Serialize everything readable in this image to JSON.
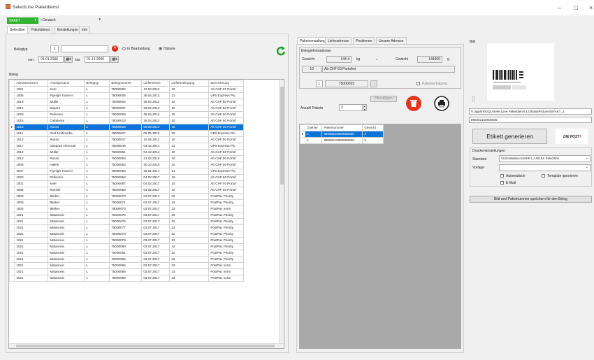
{
  "window": {
    "title": "SelectLine Paketdienst"
  },
  "top": {
    "mandant": "SFAKT",
    "language": "Deutsch"
  },
  "menu_tabs": [
    "Selectline",
    "Paketdienst",
    "Einstellungen",
    "Info"
  ],
  "filter": {
    "belegtyp_label": "Belegtyp",
    "belegtyp_value": "L",
    "von_label": "von",
    "von_value": "01.01.2000",
    "bis_label": "bis",
    "bis_value": "01.12.2050",
    "radio1": "In Bearbeitung",
    "radio2": "Historie"
  },
  "beleg_label": "Beleg",
  "table": {
    "columns": [
      "Adressnummer",
      "Anzeigename",
      "Belegtyp",
      "Belegnummer",
      "Liefertermin",
      "Lieferbedingung",
      "Bezeichnung"
    ],
    "rows": [
      [
        "1001",
        "Keel",
        "L",
        "75000002",
        "12.04.2012",
        "10",
        "Ab CHF 50 Portof"
      ],
      [
        "1005",
        "FlyHigh Travel A",
        "L",
        "75000005",
        "29.04.2012",
        "21",
        "UPS Express Plu"
      ],
      [
        "1019",
        "Müller",
        "L",
        "75000006",
        "25.04.2012",
        "10",
        "Ab CHF 50 Portof"
      ],
      [
        "1012",
        "Dupont",
        "L",
        "75000007",
        "25.04.2012",
        "10",
        "Ab CHF 50 Portof"
      ],
      [
        "1020",
        "Pellicano",
        "L",
        "75000008",
        "25.04.2012",
        "10",
        "Ab CHF 50 Portof"
      ],
      [
        "1015",
        "Calabrese",
        "L",
        "75000010",
        "25.04.2012",
        "10",
        "Ab CHF 50 Portof"
      ],
      [
        "1013",
        "Russo",
        "L",
        "75000025",
        "06.05.2012",
        "10",
        "Ab CHF 50 Portof"
      ],
      [
        "1011",
        "Graf Multimedia",
        "L",
        "75000027",
        "05.05.2012",
        "20",
        "UPS Express Plu"
      ],
      [
        "1013",
        "Russo",
        "L",
        "75000027",
        "10.05.2012",
        "10",
        "Ab CHF 50 Portof"
      ],
      [
        "1017",
        "Gaspard Informati",
        "L",
        "75000048",
        "04.12.2014",
        "21",
        "UPS Express Plu"
      ],
      [
        "1019",
        "Müller",
        "L",
        "75000051",
        "04.12.2014",
        "10",
        "Ab CHF 50 Portof"
      ],
      [
        "1013",
        "Russo",
        "L",
        "75000060",
        "21.03.2016",
        "10",
        "Ab CHF 50 Portof"
      ],
      [
        "1006",
        "Halleli",
        "L",
        "75000063",
        "30.10.2016",
        "10",
        "Ab CHF 50 Portof"
      ],
      [
        "1007",
        "FlyHigh Travel A",
        "L",
        "75000063",
        "26.01.2017",
        "21",
        "UPS Express Plu"
      ],
      [
        "1020",
        "Pellicano",
        "L",
        "75000064",
        "04.02.2017",
        "10",
        "Ab CHF 50 Portof"
      ],
      [
        "1001",
        "Keel",
        "L",
        "75000067",
        "04.02.2017",
        "10",
        "Ab CHF 50 Portof"
      ],
      [
        "1006",
        "Rossini",
        "L",
        "75000068",
        "04.02.2017",
        "10",
        "Ab CHF 50 Portof"
      ],
      [
        "1003",
        "Bleiker",
        "L",
        "75000070",
        "03.07.2017",
        "22",
        "PostPac Priority"
      ],
      [
        "1003",
        "Bleiker",
        "L",
        "75000071",
        "03.07.2017",
        "22",
        "PostPac Priority"
      ],
      [
        "1003",
        "Bleiker",
        "L",
        "75000073",
        "03.07.2017",
        "23",
        "PostPac norm"
      ],
      [
        "1021",
        "Matanovic",
        "L",
        "75000075",
        "03.07.2017",
        "22",
        "PostPac Priority"
      ],
      [
        "1021",
        "Matanovic",
        "L",
        "75000076",
        "03.07.2017",
        "22",
        "PostPac Priority"
      ],
      [
        "1021",
        "Matanovic",
        "L",
        "75000077",
        "03.07.2017",
        "22",
        "PostPac Priority"
      ],
      [
        "1021",
        "Matanovic",
        "L",
        "75000078",
        "03.07.2017",
        "22",
        "PostPac Priority"
      ],
      [
        "1021",
        "Matanovic",
        "L",
        "75000079",
        "03.07.2017",
        "22",
        "PostPac Priority"
      ],
      [
        "1021",
        "Matanovic",
        "L",
        "75000080",
        "03.07.2017",
        "22",
        "PostPac Priority"
      ],
      [
        "1021",
        "Matanovic",
        "L",
        "75000081",
        "03.07.2017",
        "22",
        "PostPac Priority"
      ],
      [
        "1021",
        "Matanovic",
        "L",
        "75000082",
        "03.07.2017",
        "22",
        "PostPac Priority"
      ],
      [
        "1021",
        "Matanovic",
        "L",
        "75000084",
        "03.07.2017",
        "23",
        "PostPac norm"
      ],
      [
        "1021",
        "Matanovic",
        "L",
        "75000085",
        "03.07.2017",
        "23",
        "PostPac norm"
      ],
      [
        "1021",
        "Matanovic",
        "L",
        "75000086",
        "03.07.2017",
        "23",
        "PostPac norm"
      ]
    ],
    "selected_row": 6
  },
  "mid_tabs": [
    "Paketverwaltung",
    "Lieferadresse",
    "Positionen",
    "Unsere Adresse"
  ],
  "beleginfo": {
    "title": "Beleginformationen",
    "gewicht_label": "Gewicht",
    "gewicht_value": "144.4",
    "unit": "kg",
    "gewicht2_label": "Gewicht",
    "gewicht2_value": "144400",
    "unit2": "g",
    "cond_code": "10",
    "cond_text": "Ab CHF 50 Portofrei",
    "belegtyp": "L",
    "belegnummer": "75000025",
    "paketverf": "Paketverfolgung",
    "anzahl_label": "Anzahl Pakete",
    "anzahl_value": "2",
    "hinzu_btn": "Hinzufügen"
  },
  "packages": {
    "columns": [
      "Zaehler",
      "Paketnummer",
      "Gewicht"
    ],
    "rows": [
      [
        "1",
        "99600215060060505",
        "2"
      ],
      [
        "1",
        "99600215060060506",
        "3"
      ]
    ]
  },
  "right": {
    "bild_label": "Bild",
    "path": "V:\\app\\ink\\SQL\\SelectLine Paketdienst 1.0\\Data\\Pictures\\SFAKT_1",
    "code": "996002150600605",
    "etikett_btn": "Etikett generieren",
    "logo": "DIE POST",
    "drucker_title": "Druckereinstellungen",
    "standard_label": "Standard",
    "standard_value": "\\\\S3.trabalia.local\\HP LJ 4015X Selectline",
    "vorlage_label": "Vorlage",
    "auto_label": "Automatisch",
    "template_label": "Template ignorieren",
    "email_label": "E-Mail",
    "save_btn": "Bild und Paketnummer speichern für den Beleg"
  }
}
